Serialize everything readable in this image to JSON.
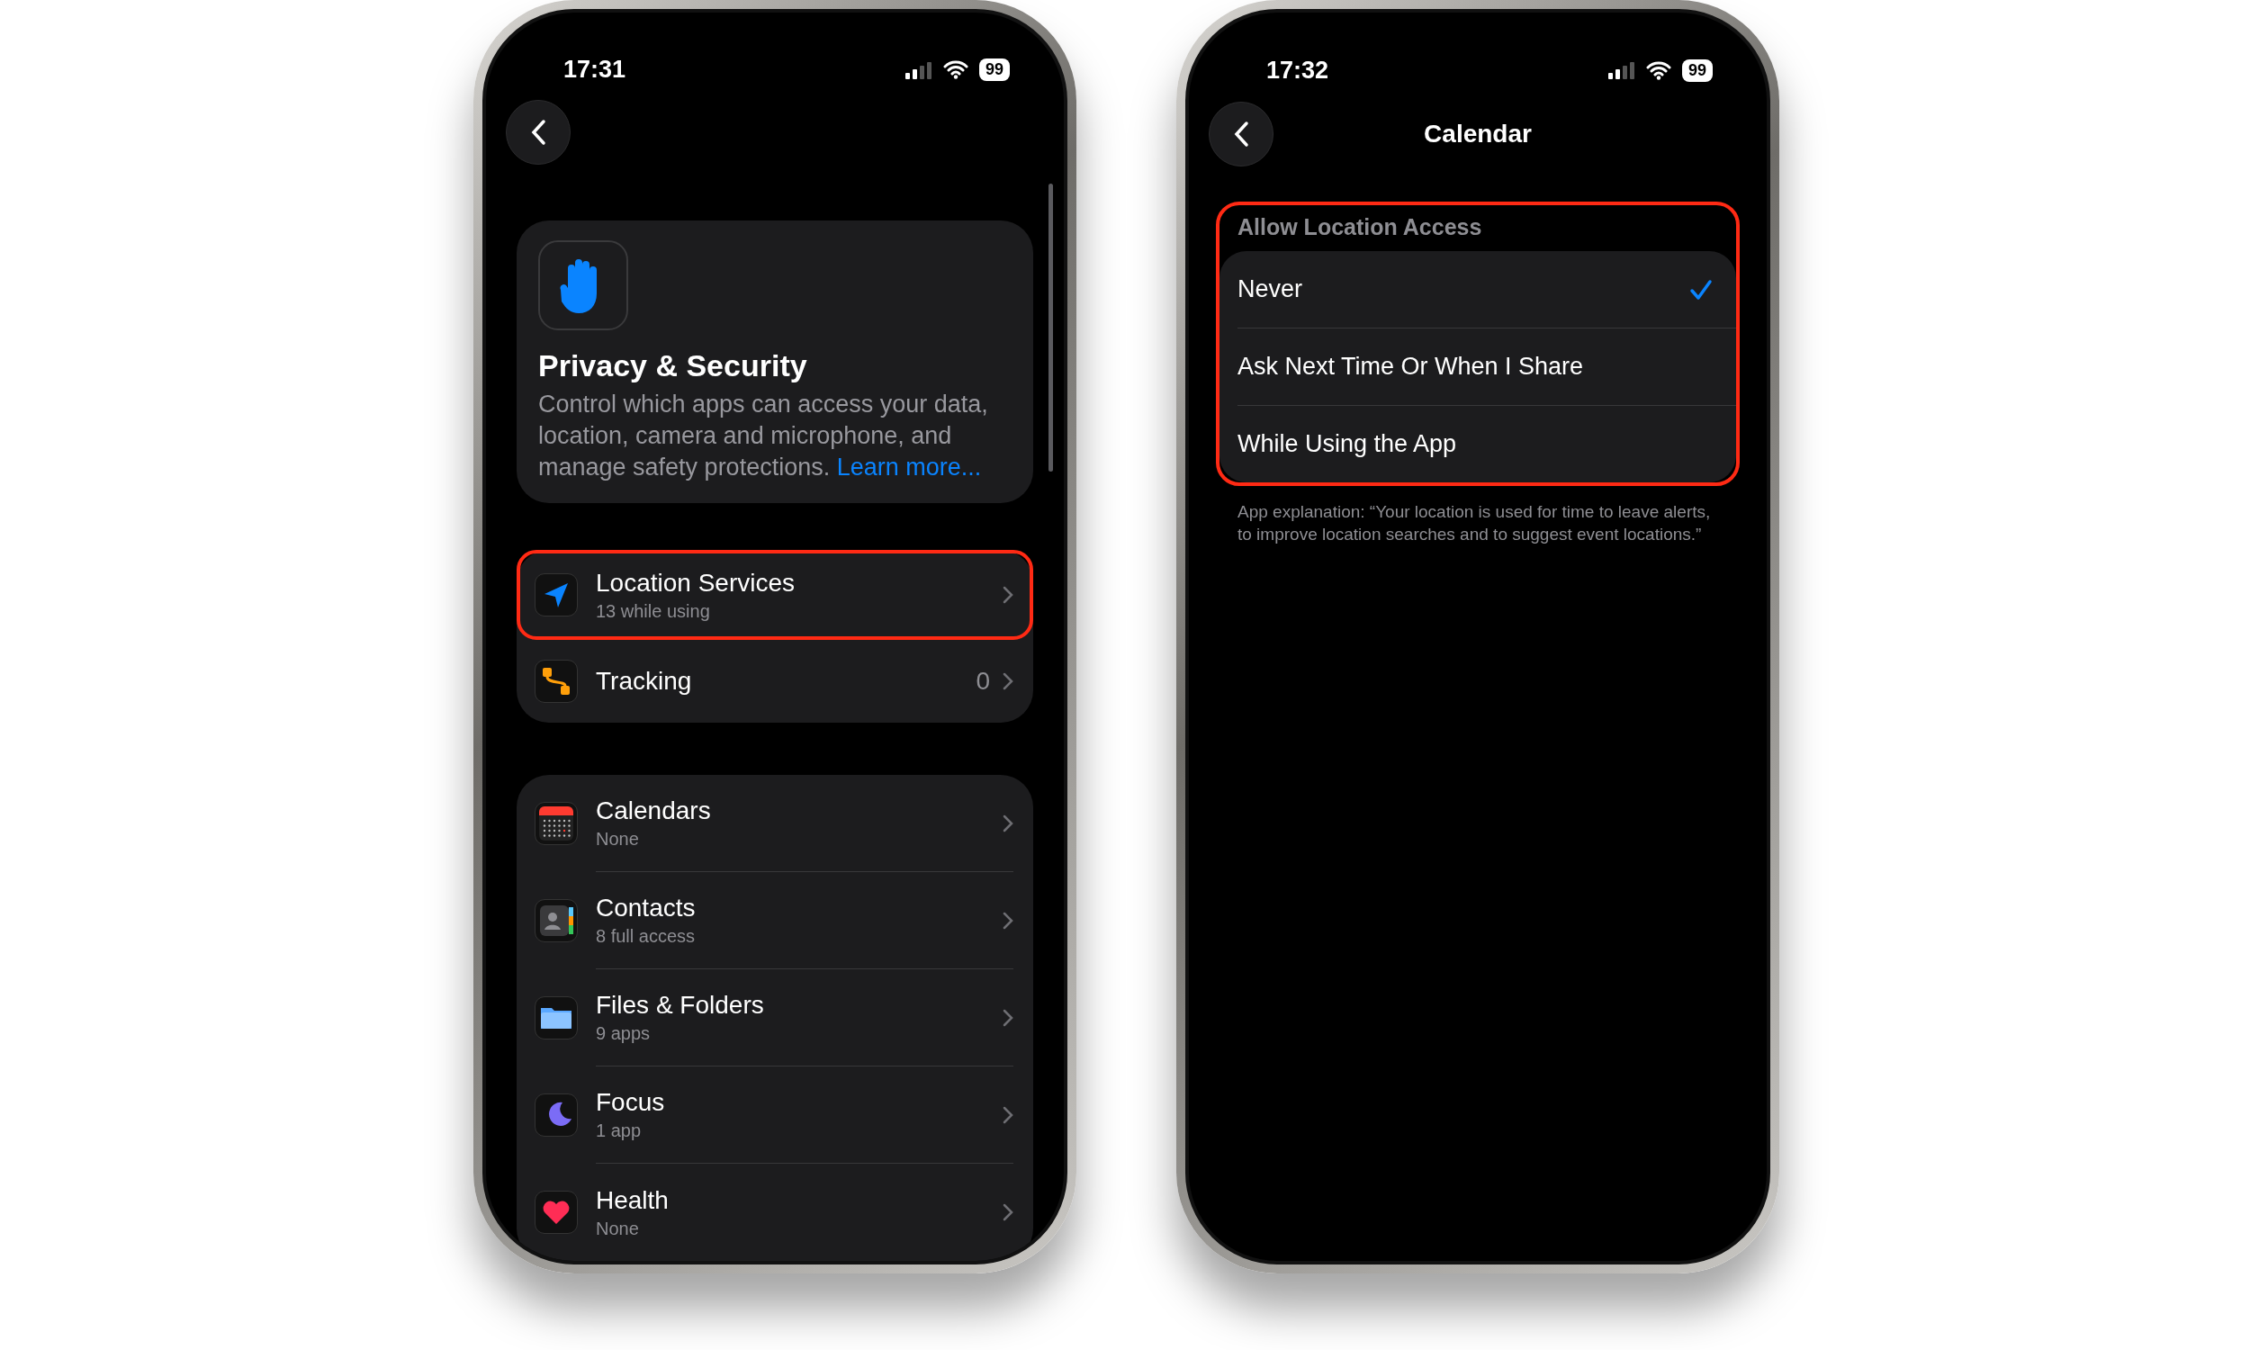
{
  "phones": [
    {
      "kind": "privacy",
      "status": {
        "time": "17:31",
        "battery": "99"
      },
      "header": {
        "title": "Privacy & Security",
        "description": "Control which apps can access your data, location, camera and microphone, and manage safety protections.",
        "link": "Learn more..."
      },
      "groups": [
        {
          "items": [
            {
              "label": "Location Services",
              "detail": "13 while using",
              "highlighted": true
            },
            {
              "label": "Tracking",
              "value": "0",
              "highlighted": false
            }
          ]
        },
        {
          "items": [
            {
              "label": "Calendars",
              "detail": "None",
              "highlighted": false
            },
            {
              "label": "Contacts",
              "detail": "8 full access",
              "highlighted": false
            },
            {
              "label": "Files & Folders",
              "detail": "9 apps",
              "highlighted": false
            },
            {
              "label": "Focus",
              "detail": "1 app",
              "highlighted": false
            },
            {
              "label": "Health",
              "detail": "None",
              "highlighted": false
            }
          ]
        }
      ]
    },
    {
      "kind": "detail",
      "status": {
        "time": "17:32",
        "battery": "99"
      },
      "title": "Calendar",
      "section": {
        "header": "Allow Location Access",
        "highlighted": true,
        "options": [
          {
            "label": "Never",
            "selected": true
          },
          {
            "label": "Ask Next Time Or When I Share",
            "selected": false
          },
          {
            "label": "While Using the App",
            "selected": false
          }
        ],
        "footer": "App explanation: “Your location is used for time to leave alerts, to improve location searches and to suggest event locations.”"
      }
    }
  ]
}
